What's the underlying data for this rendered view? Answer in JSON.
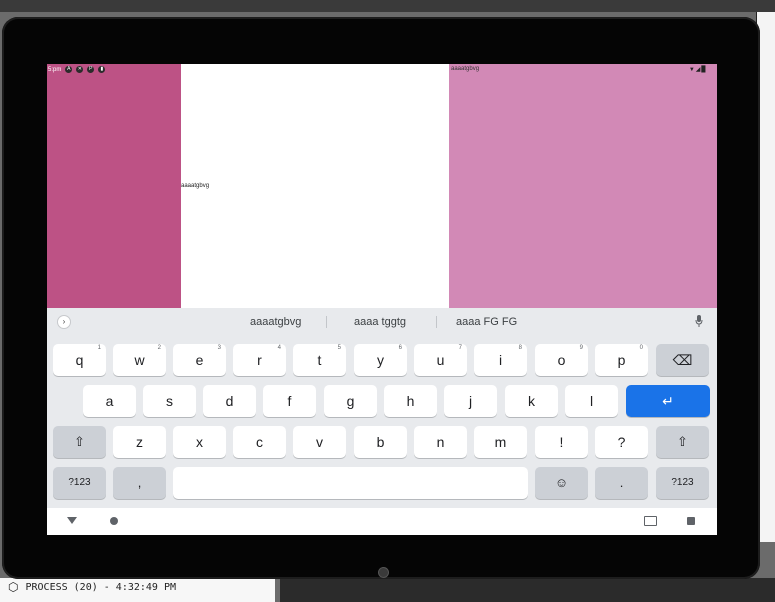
{
  "status_bar": {
    "left_text": "5:pm",
    "right_text": "aaaatgbvg",
    "right_icons": "▼◢▉"
  },
  "mid_panel_text": "aaaatgbvg",
  "suggestions": [
    "aaaatgbvg",
    "aaaa tggtg",
    "aaaa FG FG"
  ],
  "keyboard": {
    "row1": [
      {
        "label": "q",
        "hint": "1"
      },
      {
        "label": "w",
        "hint": "2"
      },
      {
        "label": "e",
        "hint": "3"
      },
      {
        "label": "r",
        "hint": "4"
      },
      {
        "label": "t",
        "hint": "5"
      },
      {
        "label": "y",
        "hint": "6"
      },
      {
        "label": "u",
        "hint": "7"
      },
      {
        "label": "i",
        "hint": "8"
      },
      {
        "label": "o",
        "hint": "9"
      },
      {
        "label": "p",
        "hint": "0"
      }
    ],
    "row2": [
      "a",
      "s",
      "d",
      "f",
      "g",
      "h",
      "j",
      "k",
      "l"
    ],
    "row3": [
      "z",
      "x",
      "c",
      "v",
      "b",
      "n",
      "m",
      "!",
      "?"
    ],
    "symbols_label": "?123",
    "comma_label": ",",
    "period_label": ".",
    "emoji_glyph": "☺",
    "backspace_glyph": "⌫",
    "enter_glyph": "↵",
    "shift_glyph": "⇧"
  },
  "process_bar": {
    "icon": "cube-icon",
    "text": "PROCESS (20) - 4:32:49 PM"
  },
  "colors": {
    "panel_left": "#bd5285",
    "panel_right": "#d289b6",
    "enter_key": "#1a73e8",
    "keyboard_bg": "#e8eaed"
  }
}
